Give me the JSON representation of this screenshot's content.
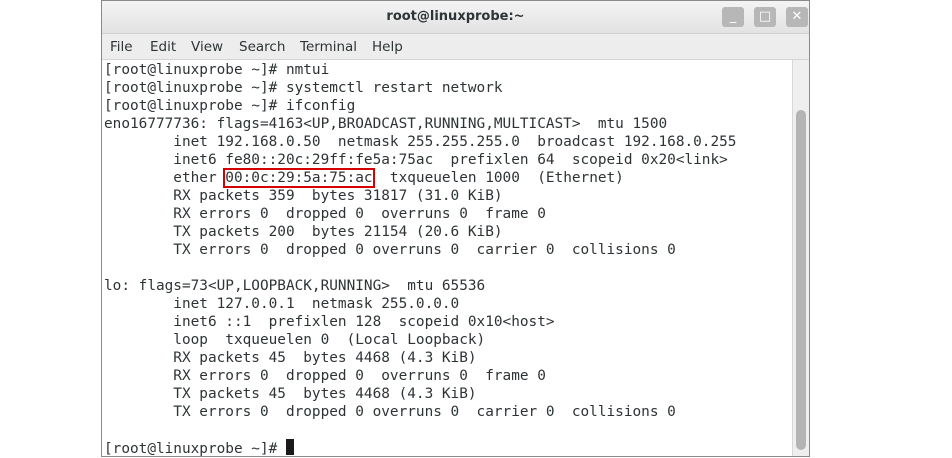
{
  "window": {
    "title": "root@linuxprobe:~",
    "buttons": {
      "minimize": "_",
      "maximize": "□",
      "close": "✕"
    }
  },
  "menu": [
    "File",
    "Edit",
    "View",
    "Search",
    "Terminal",
    "Help"
  ],
  "terminal": {
    "lines": [
      "[root@linuxprobe ~]# nmtui",
      "[root@linuxprobe ~]# systemctl restart network",
      "[root@linuxprobe ~]# ifconfig",
      "eno16777736: flags=4163<UP,BROADCAST,RUNNING,MULTICAST>  mtu 1500",
      "        inet 192.168.0.50  netmask 255.255.255.0  broadcast 192.168.0.255",
      "        inet6 fe80::20c:29ff:fe5a:75ac  prefixlen 64  scopeid 0x20<link>",
      "",
      "        RX packets 359  bytes 31817 (31.0 KiB)",
      "        RX errors 0  dropped 0  overruns 0  frame 0",
      "        TX packets 200  bytes 21154 (20.6 KiB)",
      "        TX errors 0  dropped 0 overruns 0  carrier 0  collisions 0",
      "",
      "lo: flags=73<UP,LOOPBACK,RUNNING>  mtu 65536",
      "        inet 127.0.0.1  netmask 255.0.0.0",
      "        inet6 ::1  prefixlen 128  scopeid 0x10<host>",
      "        loop  txqueuelen 0  (Local Loopback)",
      "        RX packets 45  bytes 4468 (4.3 KiB)",
      "        RX errors 0  dropped 0  overruns 0  frame 0",
      "        TX packets 45  bytes 4468 (4.3 KiB)",
      "        TX errors 0  dropped 0 overruns 0  carrier 0  collisions 0",
      "",
      "[root@linuxprobe ~]# "
    ],
    "ether_line": {
      "prefix": "        ether ",
      "mac": "00:0c:29:5a:75:ac",
      "suffix": "  txqueuelen 1000  (Ethernet)"
    },
    "colors": {
      "highlight": "#d40000",
      "text": "#2e3436"
    }
  }
}
